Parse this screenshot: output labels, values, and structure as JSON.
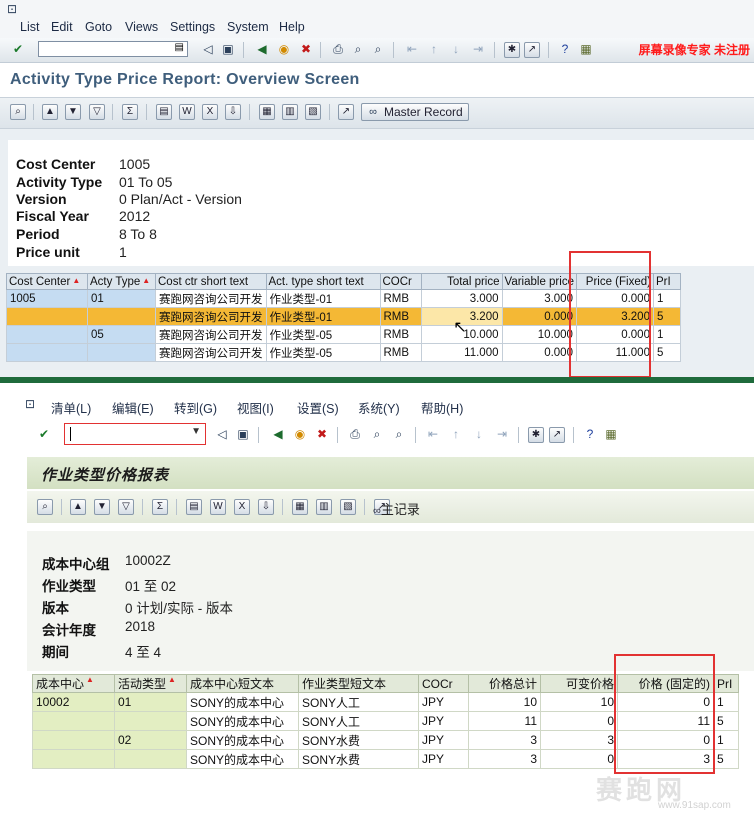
{
  "top": {
    "menu": [
      "List",
      "Edit",
      "Goto",
      "Views",
      "Settings",
      "System",
      "Help"
    ],
    "watermark": "屏幕录像专家  未注册",
    "screen_title": "Activity Type Price Report: Overview Screen",
    "master_record_label": "Master Record",
    "header": [
      {
        "label": "Cost Center",
        "value": "1005"
      },
      {
        "label": "Activity Type",
        "value": "01 To 05"
      },
      {
        "label": "Version",
        "value": "0 Plan/Act - Version"
      },
      {
        "label": "Fiscal Year",
        "value": "2012"
      },
      {
        "label": "Period",
        "value": "8 To 8"
      },
      {
        "label": "Price unit",
        "value": "1"
      }
    ],
    "columns": [
      "Cost Center",
      "Acty Type",
      "Cost ctr short text",
      "Act. type short text",
      "COCr",
      "Total price",
      "Variable price",
      "Price (Fixed)",
      "PrI"
    ],
    "rows": [
      {
        "cc": "1005",
        "at": "01",
        "cctext": "赛跑网咨询公司开发",
        "attext": "作业类型-01",
        "cur": "RMB",
        "total": "3.000",
        "var": "3.000",
        "fixed": "0.000",
        "pri": "1"
      },
      {
        "cc": "",
        "at": "",
        "cctext": "赛跑网咨询公司开发",
        "attext": "作业类型-01",
        "cur": "RMB",
        "total": "3.200",
        "var": "0.000",
        "fixed": "3.200",
        "pri": "5"
      },
      {
        "cc": "",
        "at": "05",
        "cctext": "赛跑网咨询公司开发",
        "attext": "作业类型-05",
        "cur": "RMB",
        "total": "10.000",
        "var": "10.000",
        "fixed": "0.000",
        "pri": "1"
      },
      {
        "cc": "",
        "at": "",
        "cctext": "赛跑网咨询公司开发",
        "attext": "作业类型-05",
        "cur": "RMB",
        "total": "11.000",
        "var": "0.000",
        "fixed": "11.000",
        "pri": "5"
      }
    ]
  },
  "bottom": {
    "menu": [
      "清单(L)",
      "编辑(E)",
      "转到(G)",
      "视图(I)",
      "设置(S)",
      "系统(Y)",
      "帮助(H)"
    ],
    "screen_title": "作业类型价格报表",
    "master_record_label": "主记录",
    "header": [
      {
        "label": "成本中心组",
        "value": "10002Z"
      },
      {
        "label": "作业类型",
        "value": "01 至 02"
      },
      {
        "label": "版本",
        "value": "0 计划/实际 - 版本"
      },
      {
        "label": "会计年度",
        "value": "2018"
      },
      {
        "label": "期间",
        "value": "4 至 4"
      }
    ],
    "columns": [
      "成本中心",
      "活动类型",
      "成本中心短文本",
      "作业类型短文本",
      "COCr",
      "价格总计",
      "可变价格",
      "价格 (固定的)",
      "PrI"
    ],
    "rows": [
      {
        "cc": "10002",
        "at": "01",
        "cctext": "SONY的成本中心",
        "attext": "SONY人工",
        "cur": "JPY",
        "total": "10",
        "var": "10",
        "fixed": "0",
        "pri": "1"
      },
      {
        "cc": "",
        "at": "",
        "cctext": "SONY的成本中心",
        "attext": "SONY人工",
        "cur": "JPY",
        "total": "11",
        "var": "0",
        "fixed": "11",
        "pri": "5"
      },
      {
        "cc": "",
        "at": "02",
        "cctext": "SONY的成本中心",
        "attext": "SONY水费",
        "cur": "JPY",
        "total": "3",
        "var": "3",
        "fixed": "0",
        "pri": "1"
      },
      {
        "cc": "",
        "at": "",
        "cctext": "SONY的成本中心",
        "attext": "SONY水费",
        "cur": "JPY",
        "total": "3",
        "var": "0",
        "fixed": "3",
        "pri": "5"
      }
    ]
  },
  "logo": {
    "text": "赛跑网",
    "url": "www.91sap.com"
  },
  "colors": {
    "highlight_row": "#f4b835",
    "red_box": "#e23232",
    "divider": "#1f6b3c"
  }
}
